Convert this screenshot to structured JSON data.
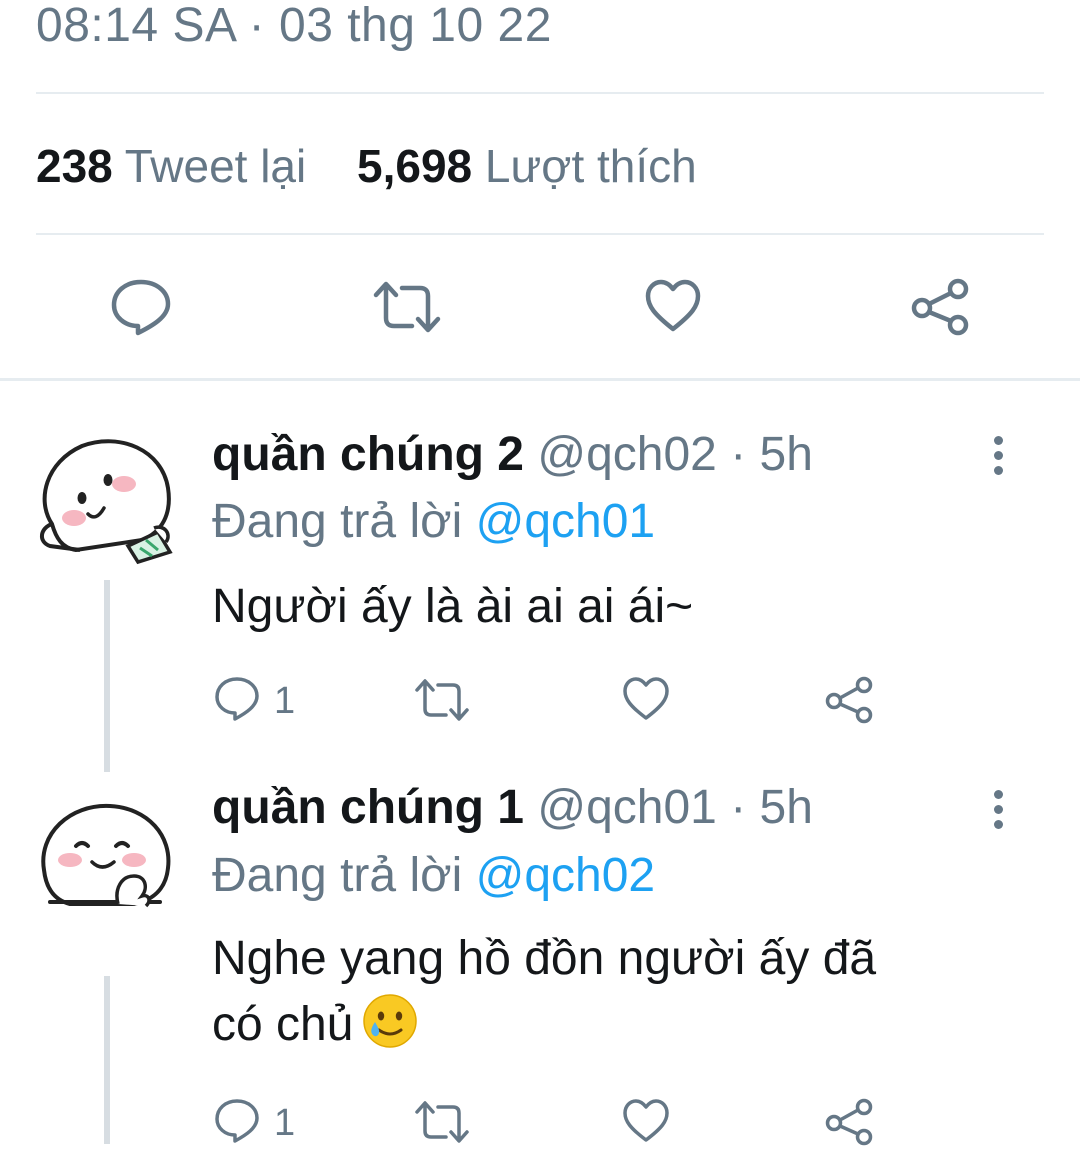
{
  "tweet": {
    "timestamp": "08:14 SA · 03 thg 10 22",
    "retweets_count": "238",
    "retweets_label": "Tweet lại",
    "likes_count": "5,698",
    "likes_label": "Lượt thích"
  },
  "replies": [
    {
      "name": "quần chúng 2",
      "handle": "@qch02",
      "separator": "·",
      "time": "5h",
      "replying_label": "Đang trả lời",
      "replying_to": "@qch01",
      "text": "Người ấy là ài ai ai ái~",
      "reply_count": "1"
    },
    {
      "name": "quần chúng 1",
      "handle": "@qch01",
      "separator": "·",
      "time": "5h",
      "replying_label": "Đang trả lời",
      "replying_to": "@qch02",
      "text_line1": "Nghe yang hồ đồn người ấy đã",
      "text_line2": "có chủ",
      "emoji": "smiling-face-with-tear",
      "reply_count": "1"
    }
  ],
  "colors": {
    "text": "#14171a",
    "secondary": "#657786",
    "accent": "#1da1f2",
    "divider": "#e6ecf0"
  }
}
